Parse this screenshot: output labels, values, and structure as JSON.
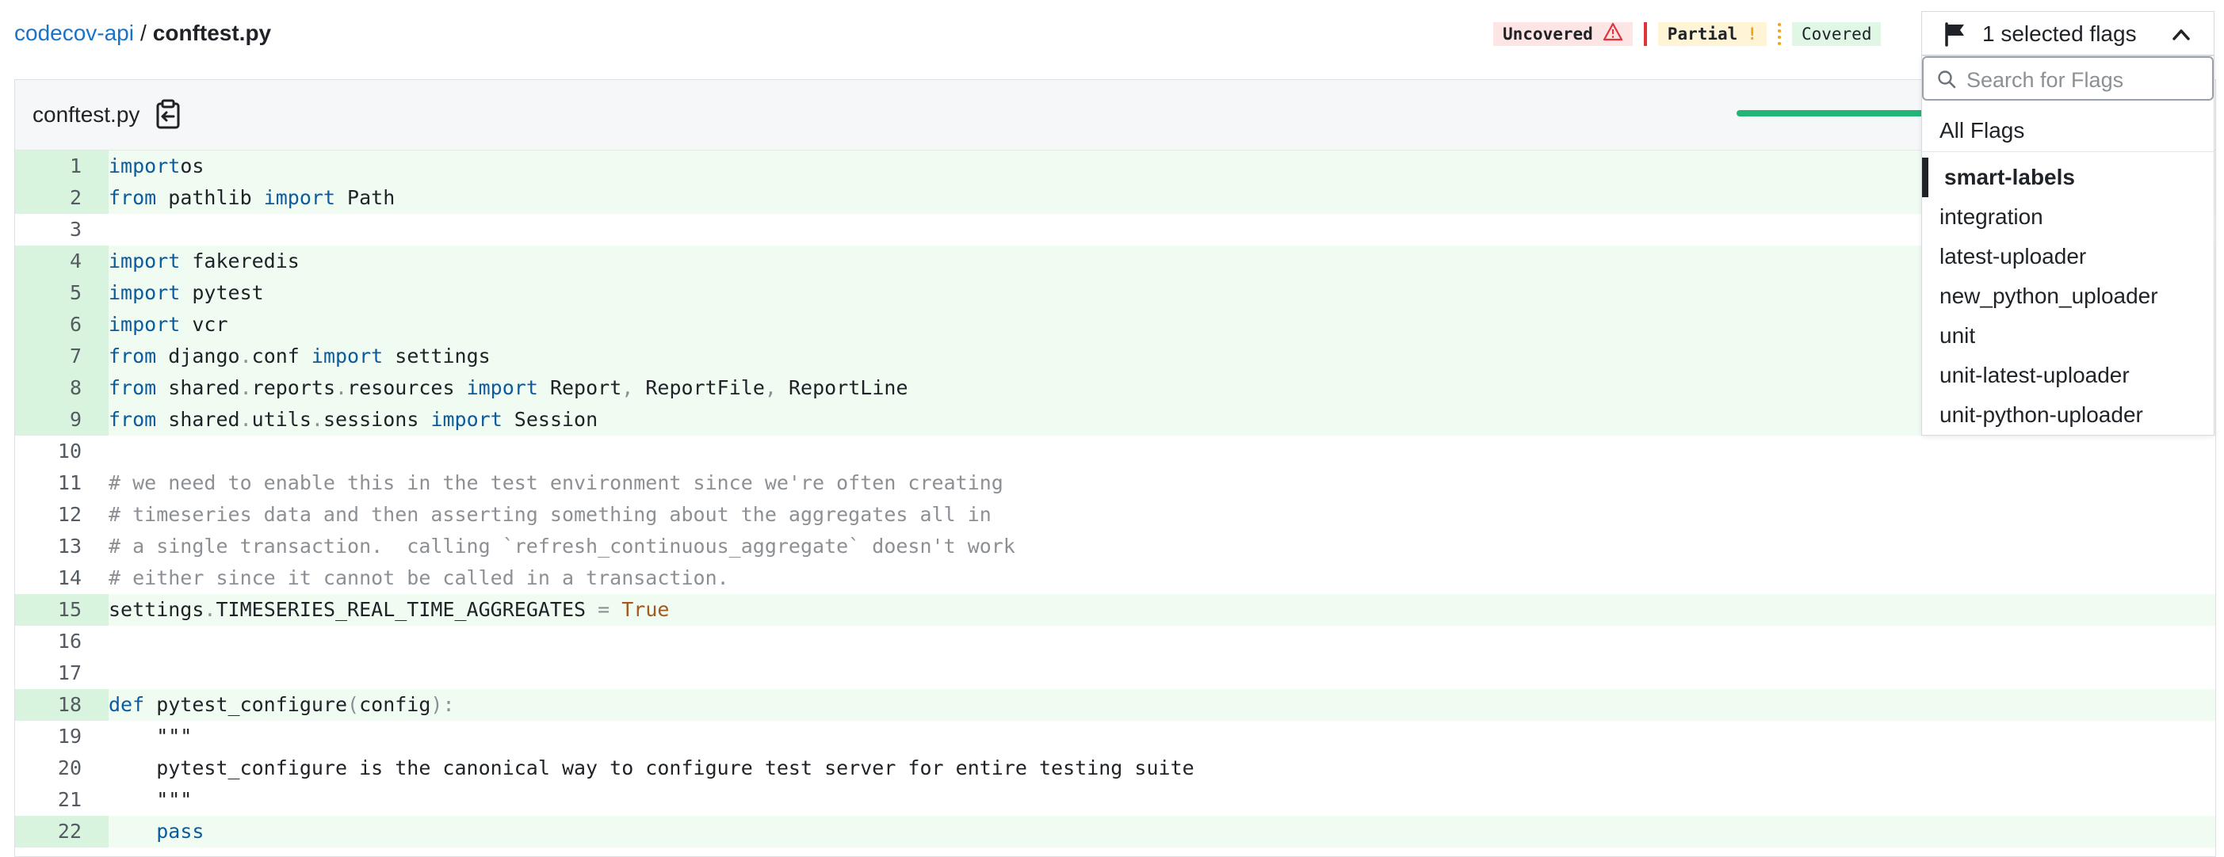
{
  "breadcrumb": {
    "repo": "codecov-api",
    "separator": "/",
    "file": "conftest.py"
  },
  "legend": {
    "uncovered": "Uncovered",
    "uncovered_icon": "warning-triangle-icon",
    "partial": "Partial",
    "partial_icon": "exclamation-icon",
    "covered": "Covered",
    "colors": {
      "uncovered": "#e2333a",
      "partial": "#f3a50d",
      "covered": "#21b577"
    }
  },
  "flags_dropdown": {
    "button_label": "1 selected flags",
    "search_placeholder": "Search for Flags",
    "all_label": "All Flags",
    "items": [
      {
        "label": "smart-labels",
        "selected": true
      },
      {
        "label": "integration",
        "selected": false
      },
      {
        "label": "latest-uploader",
        "selected": false
      },
      {
        "label": "new_python_uploader",
        "selected": false
      },
      {
        "label": "unit",
        "selected": false
      },
      {
        "label": "unit-latest-uploader",
        "selected": false
      },
      {
        "label": "unit-python-uploader",
        "selected": false
      }
    ]
  },
  "file_panel": {
    "filename": "conftest.py",
    "lines": [
      {
        "n": "1",
        "covered": true,
        "tokens": [
          [
            "kw",
            "import"
          ],
          [
            "",
            "os"
          ]
        ]
      },
      {
        "n": "2",
        "covered": true,
        "tokens": [
          [
            "kw",
            "from"
          ],
          [
            "",
            " pathlib "
          ],
          [
            "kw",
            "import"
          ],
          [
            "",
            " Path"
          ]
        ]
      },
      {
        "n": "3",
        "covered": false,
        "tokens": []
      },
      {
        "n": "4",
        "covered": true,
        "tokens": [
          [
            "kw",
            "import"
          ],
          [
            "",
            " fakeredis"
          ]
        ]
      },
      {
        "n": "5",
        "covered": true,
        "tokens": [
          [
            "kw",
            "import"
          ],
          [
            "",
            " pytest"
          ]
        ]
      },
      {
        "n": "6",
        "covered": true,
        "tokens": [
          [
            "kw",
            "import"
          ],
          [
            "",
            " vcr"
          ]
        ]
      },
      {
        "n": "7",
        "covered": true,
        "tokens": [
          [
            "kw",
            "from"
          ],
          [
            "",
            " django"
          ],
          [
            "pn",
            "."
          ],
          [
            "",
            "conf "
          ],
          [
            "kw",
            "import"
          ],
          [
            "",
            " settings"
          ]
        ]
      },
      {
        "n": "8",
        "covered": true,
        "tokens": [
          [
            "kw",
            "from"
          ],
          [
            "",
            " shared"
          ],
          [
            "pn",
            "."
          ],
          [
            "",
            "reports"
          ],
          [
            "pn",
            "."
          ],
          [
            "",
            "resources "
          ],
          [
            "kw",
            "import"
          ],
          [
            "",
            " Report"
          ],
          [
            "pn",
            ","
          ],
          [
            "",
            " ReportFile"
          ],
          [
            "pn",
            ","
          ],
          [
            "",
            " ReportLine"
          ]
        ]
      },
      {
        "n": "9",
        "covered": true,
        "tokens": [
          [
            "kw",
            "from"
          ],
          [
            "",
            " shared"
          ],
          [
            "pn",
            "."
          ],
          [
            "",
            "utils"
          ],
          [
            "pn",
            "."
          ],
          [
            "",
            "sessions "
          ],
          [
            "kw",
            "import"
          ],
          [
            "",
            " Session"
          ]
        ]
      },
      {
        "n": "10",
        "covered": false,
        "tokens": []
      },
      {
        "n": "11",
        "covered": false,
        "tokens": [
          [
            "cm",
            "# we need to enable this in the test environment since we're often creating"
          ]
        ]
      },
      {
        "n": "12",
        "covered": false,
        "tokens": [
          [
            "cm",
            "# timeseries data and then asserting something about the aggregates all in"
          ]
        ]
      },
      {
        "n": "13",
        "covered": false,
        "tokens": [
          [
            "cm",
            "# a single transaction.  calling `refresh_continuous_aggregate` doesn't work"
          ]
        ]
      },
      {
        "n": "14",
        "covered": false,
        "tokens": [
          [
            "cm",
            "# either since it cannot be called in a transaction."
          ]
        ]
      },
      {
        "n": "15",
        "covered": true,
        "tokens": [
          [
            "",
            "settings"
          ],
          [
            "pn",
            "."
          ],
          [
            "",
            "TIMESERIES_REAL_TIME_AGGREGATES "
          ],
          [
            "pn",
            "="
          ],
          [
            "bool",
            " True"
          ]
        ]
      },
      {
        "n": "16",
        "covered": false,
        "tokens": []
      },
      {
        "n": "17",
        "covered": false,
        "tokens": []
      },
      {
        "n": "18",
        "covered": true,
        "tokens": [
          [
            "kw",
            "def"
          ],
          [
            "",
            " pytest_configure"
          ],
          [
            "pn",
            "("
          ],
          [
            "",
            "config"
          ],
          [
            "pn",
            "):"
          ]
        ]
      },
      {
        "n": "19",
        "covered": false,
        "tokens": [
          [
            "",
            "    \"\"\""
          ]
        ]
      },
      {
        "n": "20",
        "covered": false,
        "tokens": [
          [
            "",
            "    pytest_configure is the canonical way to configure test server for entire testing suite"
          ]
        ]
      },
      {
        "n": "21",
        "covered": false,
        "tokens": [
          [
            "",
            "    \"\"\""
          ]
        ]
      },
      {
        "n": "22",
        "covered": true,
        "tokens": [
          [
            "",
            "    "
          ],
          [
            "kw",
            "pass"
          ]
        ]
      }
    ]
  }
}
